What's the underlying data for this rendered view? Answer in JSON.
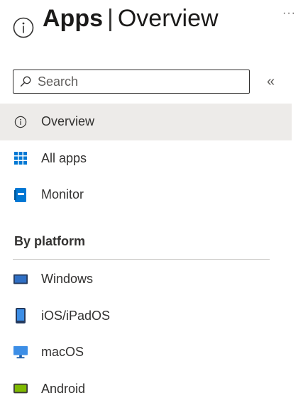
{
  "header": {
    "title_bold": "Apps",
    "separator": "|",
    "title_rest": "Overview",
    "more": "···"
  },
  "search": {
    "placeholder": "Search",
    "collapse_glyph": "«"
  },
  "nav": {
    "items": [
      {
        "label": "Overview",
        "icon": "info-icon",
        "active": true
      },
      {
        "label": "All apps",
        "icon": "grid-icon"
      },
      {
        "label": "Monitor",
        "icon": "monitor-book-icon"
      }
    ]
  },
  "platform": {
    "heading": "By platform",
    "items": [
      {
        "label": "Windows",
        "icon": "windows-device-icon"
      },
      {
        "label": "iOS/iPadOS",
        "icon": "phone-icon"
      },
      {
        "label": "macOS",
        "icon": "desktop-icon"
      },
      {
        "label": "Android",
        "icon": "android-device-icon"
      }
    ]
  },
  "colors": {
    "accent": "#0078d4",
    "active_bg": "#edebe9",
    "android_green": "#7fba00"
  }
}
